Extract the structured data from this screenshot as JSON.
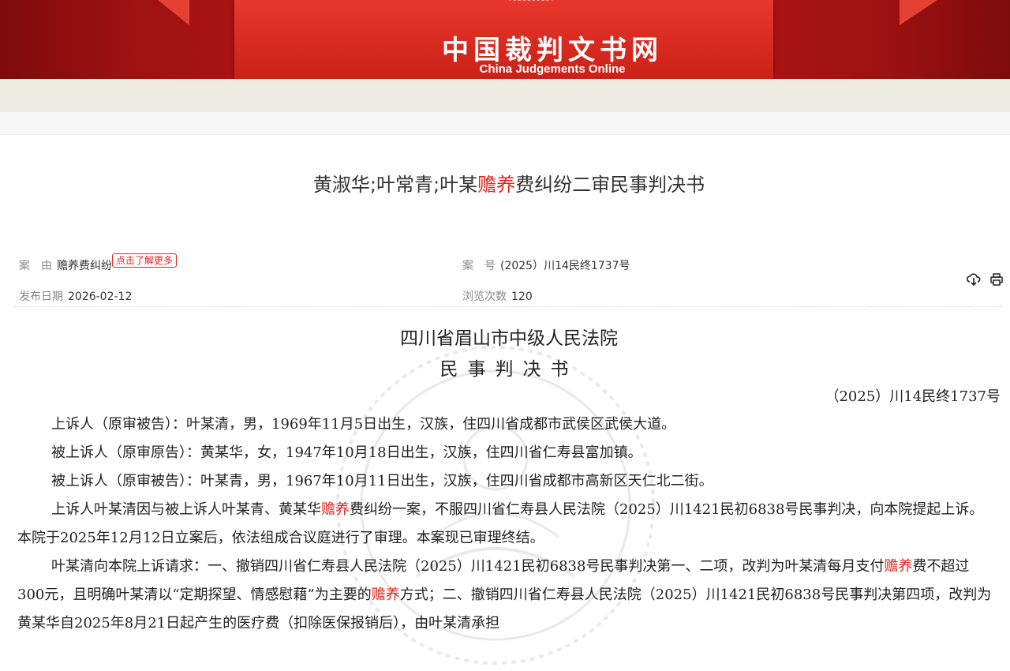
{
  "header": {
    "site_title_zh": "中国裁判文书网",
    "site_title_en": "China Judgements Online"
  },
  "document": {
    "title_parts": [
      "黄淑华;叶常青;叶某",
      "赡养",
      "费纠纷二审民事判决书"
    ]
  },
  "meta": {
    "anyou_label": "案　由",
    "anyou_value": "赡养费纠纷",
    "learn_more": "点击了解更多",
    "anhao_label": "案　号",
    "anhao_value": "(2025）川14民终1737号",
    "date_label": "发布日期",
    "date_value": "2026-02-12",
    "views_label": "浏览次数",
    "views_value": "120"
  },
  "judgement": {
    "court_name": "四川省眉山市中级人民法院",
    "doc_type": "民事判决书",
    "case_number": "（2025）川14民终1737号",
    "paragraphs": [
      [
        "上诉人（原审被告）：叶某清，男，1969年11月5日出生，汉族，住四川省成都市武侯区武侯大道。"
      ],
      [
        "被上诉人（原审原告）：黄某华，女，1947年10月18日出生，汉族，住四川省仁寿县富加镇。"
      ],
      [
        "被上诉人（原审被告）：叶某青，男，1967年10月11日出生，汉族，住四川省成都市高新区天仁北二街。"
      ],
      [
        "上诉人叶某清因与被上诉人叶某青、黄某华",
        "赡养",
        "费纠纷一案，不服四川省仁寿县人民法院（2025）川1421民初6838号民事判决，向本院提起上诉。本院于2025年12月12日立案后，依法组成合议庭进行了审理。本案现已审理终结。"
      ],
      [
        "叶某清向本院上诉请求：一、撤销四川省仁寿县人民法院（2025）川1421民初6838号民事判决第一、二项，改判为叶某清每月支付",
        "赡养",
        "费不超过300元，且明确叶某清以“定期探望、情感慰藉”为主要的",
        "赡养",
        "方式；二、撤销四川省仁寿县人民法院（2025）川1421民初6838号民事判决第四项，改判为黄某华自2025年8月21日起产生的医疗费（扣除医保报销后），由叶某清承担"
      ]
    ]
  },
  "colors": {
    "brand_red": "#d82a20",
    "highlight": "#e0231c",
    "nav_beige": "#eeebe2"
  },
  "icons": {
    "download": "download-icon",
    "print": "print-icon"
  }
}
